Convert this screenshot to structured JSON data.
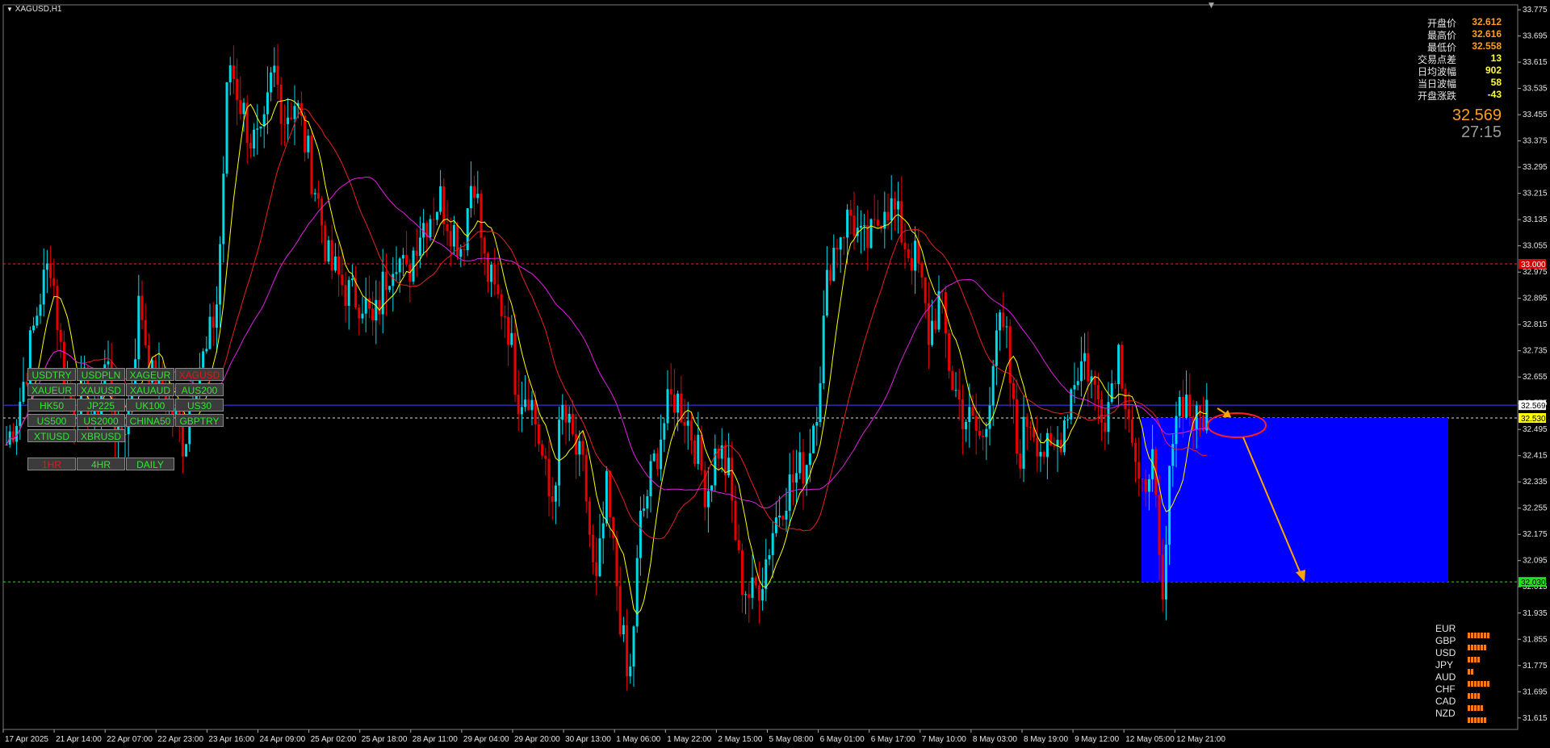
{
  "window": {
    "title": "XAGUSD,H1"
  },
  "info_panel": {
    "rows": [
      {
        "label": "开盘价",
        "value": "32.612",
        "color": "#ff9e1a"
      },
      {
        "label": "最高价",
        "value": "32.616",
        "color": "#ff9e1a"
      },
      {
        "label": "最低价",
        "value": "32.558",
        "color": "#ff9e1a"
      },
      {
        "label": "交易点差",
        "value": "13",
        "color": "#ffff33"
      },
      {
        "label": "日均波幅",
        "value": "902",
        "color": "#ffff33"
      },
      {
        "label": "当日波幅",
        "value": "58",
        "color": "#ffff33"
      },
      {
        "label": "开盘涨跌",
        "value": "-43",
        "color": "#ffff33"
      }
    ],
    "price": "32.569",
    "countdown": "27:15"
  },
  "symbol_buttons": [
    [
      "USDTRY",
      "USDPLN",
      "XAGEUR",
      "XAGUSD"
    ],
    [
      "XAUEUR",
      "XAUUSD",
      "XAUAUD",
      "AUS200"
    ],
    [
      "HK50",
      "JP225",
      "UK100",
      "US30"
    ],
    [
      "US500",
      "US2000",
      "CHINA50",
      "GBPTRY"
    ],
    [
      "XTIUSD",
      "XBRUSD"
    ]
  ],
  "active_symbol": "XAGUSD",
  "timeframe_buttons": [
    "1HR",
    "4HR",
    "DAILY"
  ],
  "active_timeframe": "1HR",
  "currency_strength": [
    {
      "name": "EUR",
      "bars": 7
    },
    {
      "name": "GBP",
      "bars": 6
    },
    {
      "name": "USD",
      "bars": 4
    },
    {
      "name": "JPY",
      "bars": 2
    },
    {
      "name": "AUD",
      "bars": 7
    },
    {
      "name": "CHF",
      "bars": 4
    },
    {
      "name": "CAD",
      "bars": 5
    },
    {
      "name": "NZD",
      "bars": 6
    }
  ],
  "colors": {
    "bull": "#00d8e8",
    "bear": "#e80000",
    "ma_fast": "#ffff00",
    "ma_mid": "#e82020",
    "ma_slow": "#e020e0",
    "target_box": "#0000ff",
    "arrow": "#ffa500",
    "level_red": "#ff2020",
    "level_green": "#20e020",
    "level_white": "#e0e0e0",
    "bid_line": "#4040ff"
  },
  "chart_data": {
    "type": "candlestick",
    "symbol": "XAGUSD",
    "timeframe": "H1",
    "ylim": [
      31.58,
      33.79
    ],
    "y_ticks": [
      "33.775",
      "33.695",
      "33.615",
      "33.535",
      "33.455",
      "33.375",
      "33.295",
      "33.215",
      "33.135",
      "33.055",
      "32.975",
      "32.895",
      "32.815",
      "32.735",
      "32.655",
      "32.575",
      "32.495",
      "32.415",
      "32.335",
      "32.255",
      "32.175",
      "32.095",
      "32.015",
      "31.935",
      "31.855",
      "31.775",
      "31.695",
      "31.615"
    ],
    "x_labels": [
      "17 Apr 2025",
      "21 Apr 14:00",
      "22 Apr 07:00",
      "22 Apr 23:00",
      "23 Apr 16:00",
      "24 Apr 09:00",
      "25 Apr 02:00",
      "25 Apr 18:00",
      "28 Apr 11:00",
      "29 Apr 04:00",
      "29 Apr 20:00",
      "30 Apr 13:00",
      "1 May 06:00",
      "1 May 22:00",
      "2 May 15:00",
      "5 May 08:00",
      "6 May 01:00",
      "6 May 17:00",
      "7 May 10:00",
      "8 May 03:00",
      "8 May 19:00",
      "9 May 12:00",
      "12 May 05:00",
      "12 May 21:00"
    ],
    "price_path": [
      32.45,
      32.55,
      32.72,
      32.9,
      33.02,
      32.7,
      32.55,
      32.62,
      32.5,
      32.72,
      32.45,
      32.55,
      32.9,
      32.65,
      32.62,
      32.55,
      32.45,
      32.68,
      32.72,
      32.9,
      33.63,
      33.5,
      33.38,
      33.35,
      33.6,
      33.45,
      33.5,
      33.35,
      33.2,
      33.0,
      32.95,
      32.9,
      32.9,
      32.8,
      32.95,
      33.05,
      32.95,
      33.1,
      33.15,
      33.2,
      33.12,
      33.05,
      33.3,
      33.0,
      32.9,
      32.85,
      32.6,
      32.62,
      32.45,
      32.25,
      32.55,
      32.45,
      32.35,
      31.98,
      32.3,
      32.0,
      31.68,
      32.2,
      32.35,
      32.5,
      32.6,
      32.55,
      32.45,
      32.3,
      32.45,
      32.35,
      32.05,
      31.98,
      32.05,
      32.2,
      32.3,
      32.35,
      32.4,
      32.6,
      33.0,
      33.1,
      33.15,
      33.05,
      33.08,
      33.2,
      33.15,
      33.05,
      33.0,
      32.78,
      32.9,
      32.65,
      32.55,
      32.5,
      32.45,
      32.82,
      32.75,
      32.4,
      32.55,
      32.45,
      32.4,
      32.5,
      32.65,
      32.72,
      32.6,
      32.55,
      32.75,
      32.55,
      32.25,
      32.45,
      31.92,
      32.55,
      32.6,
      32.5,
      32.56
    ],
    "levels": [
      {
        "price": 33.0,
        "label": "33.000",
        "kind": "red"
      },
      {
        "price": 32.53,
        "label": "32.530",
        "kind": "white"
      },
      {
        "price": 32.03,
        "label": "32.030",
        "kind": "green"
      },
      {
        "price": 32.569,
        "label": "32.569",
        "kind": "bid"
      }
    ],
    "target_zone": {
      "price_top": 32.53,
      "price_bottom": 32.03
    },
    "projection": {
      "from_price": 32.53,
      "to_price": 32.03
    }
  }
}
